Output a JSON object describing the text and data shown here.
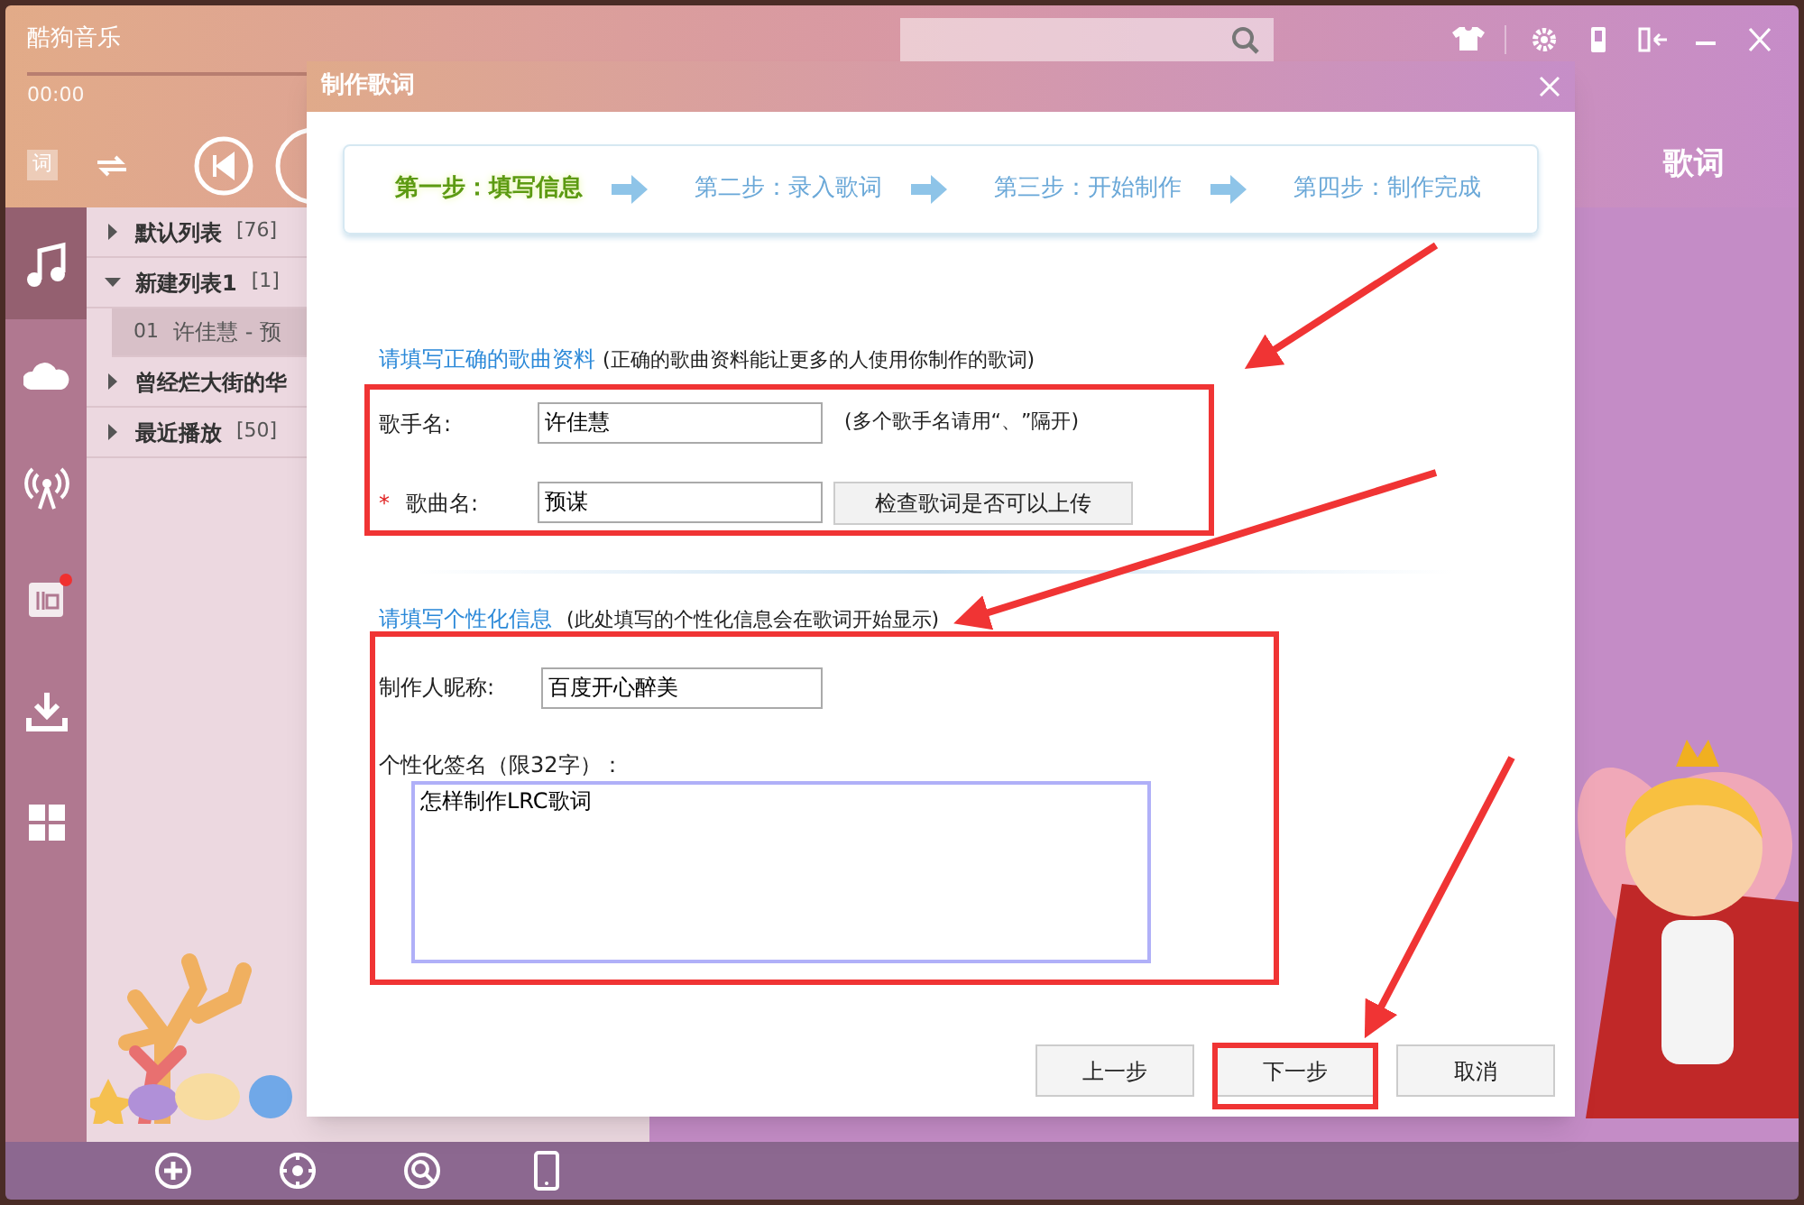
{
  "app": {
    "title": "酷狗音乐",
    "time": "00:00",
    "lyrics_toggle": "词",
    "panel_title": "歌词"
  },
  "window_controls": [
    {
      "kind": "skin"
    },
    {
      "kind": "settings"
    },
    {
      "kind": "phone"
    },
    {
      "kind": "mini"
    },
    {
      "kind": "minimize"
    },
    {
      "kind": "close"
    }
  ],
  "nav": [
    {
      "kind": "music",
      "selected": true,
      "badge": false
    },
    {
      "kind": "cloud",
      "selected": false,
      "badge": false
    },
    {
      "kind": "radio",
      "selected": false,
      "badge": false
    },
    {
      "kind": "live",
      "selected": false,
      "badge": true
    },
    {
      "kind": "download",
      "selected": false,
      "badge": false
    },
    {
      "kind": "apps",
      "selected": false,
      "badge": false
    }
  ],
  "playlists": [
    {
      "name": "默认列表",
      "count": "[76]",
      "expanded": false
    },
    {
      "name": "新建列表1",
      "count": "[1]",
      "expanded": true,
      "children": [
        {
          "number": "01",
          "title": "许佳慧 - 预",
          "selected": true
        }
      ]
    },
    {
      "name": "曾经烂大街的华",
      "expanded": false
    },
    {
      "name": "最近播放",
      "count": "[50]",
      "expanded": false
    }
  ],
  "toolbar": [
    {
      "kind": "add"
    },
    {
      "kind": "locate"
    },
    {
      "kind": "search"
    },
    {
      "kind": "phone"
    }
  ],
  "dialog": {
    "title": "制作歌词",
    "steps": [
      {
        "label": "第一步：填写信息",
        "selected": true
      },
      {
        "label": "第二步：录入歌词",
        "selected": false
      },
      {
        "label": "第三步：开始制作",
        "selected": false
      },
      {
        "label": "第四步：制作完成",
        "selected": false
      }
    ],
    "song_section": {
      "title": "请填写正确的歌曲资料",
      "note": "(正确的歌曲资料能让更多的人使用你制作的歌词)",
      "singer": {
        "label": "歌手名:",
        "value": "许佳慧",
        "hint": "(多个歌手名请用“、”隔开)"
      },
      "song": {
        "required_mark": "*",
        "label": "歌曲名:",
        "value": "预谋",
        "button": "检查歌词是否可以上传"
      }
    },
    "personal_section": {
      "title": "请填写个性化信息",
      "note": "(此处填写的个性化信息会在歌词开始显示)",
      "nickname": {
        "label": "制作人昵称:",
        "value": "百度开心醉美"
      },
      "signature": {
        "label": "个性化签名（限32字）：",
        "value": "怎样制作LRC歌词"
      }
    },
    "buttons": [
      "上一步",
      "下一步",
      "取消"
    ]
  }
}
